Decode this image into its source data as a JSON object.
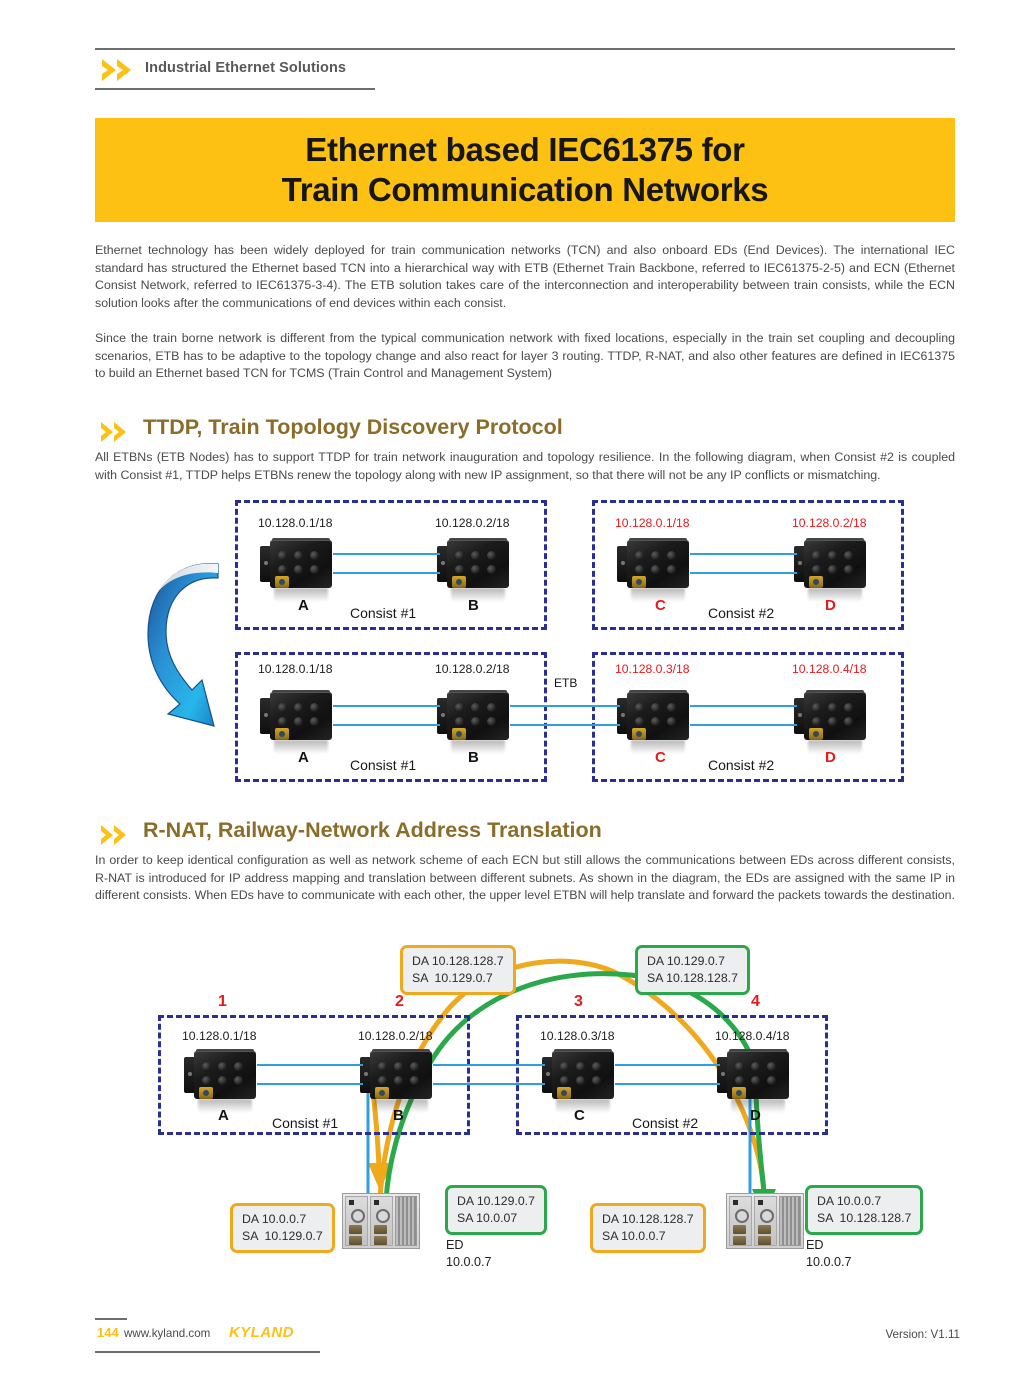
{
  "header": {
    "title": "Industrial Ethernet Solutions",
    "chevron_icon": "double-chevron-icon"
  },
  "banner": {
    "line1": "Ethernet based IEC61375 for",
    "line2": "Train Communication Networks",
    "bg_color": "#fcc113"
  },
  "intro": {
    "paragraph1": "Ethernet technology has been widely deployed for train communication networks (TCN) and also onboard EDs (End Devices). The international IEC standard has structured the Ethernet based TCN into a hierarchical way with ETB (Ethernet Train Backbone, referred to IEC61375-2-5) and ECN (Ethernet Consist Network, referred to IEC61375-3-4). The ETB solution takes care of the interconnection and interoperability between train consists, while the ECN solution looks after the communications of end devices within each consist.",
    "paragraph2": "Since the train borne network is different from the typical communication network with fixed locations, especially in the train set coupling and decoupling scenarios, ETB has to be adaptive to the topology change and also react for layer 3 routing. TTDP, R-NAT, and also other features are defined in IEC61375 to build an Ethernet based TCN for TCMS (Train Control and Management System)"
  },
  "section_ttdp": {
    "heading": "TTDP, Train Topology Discovery Protocol",
    "body": "All ETBNs (ETB Nodes) has to support TTDP for train network inauguration and topology resilience. In the following diagram, when Consist #2 is coupled with Consist #1, TTDP helps ETBNs renew the topology along with new IP assignment, so that there will not be any IP conflicts or mismatching."
  },
  "ttdp_diagram": {
    "arrow_icon": "curved-down-arrow-icon",
    "etb_label": "ETB",
    "row_before": {
      "consist1": {
        "name": "Consist #1",
        "devices": [
          {
            "letter": "A",
            "ip": "10.128.0.1/18",
            "ip_color": "#1c1c1c",
            "letter_color": "#141414"
          },
          {
            "letter": "B",
            "ip": "10.128.0.2/18",
            "ip_color": "#1c1c1c",
            "letter_color": "#141414"
          }
        ]
      },
      "consist2": {
        "name": "Consist #2",
        "devices": [
          {
            "letter": "C",
            "ip": "10.128.0.1/18",
            "ip_color": "#e8191b",
            "letter_color": "#e8191b"
          },
          {
            "letter": "D",
            "ip": "10.128.0.2/18",
            "ip_color": "#e8191b",
            "letter_color": "#e8191b"
          }
        ]
      }
    },
    "row_after": {
      "consist1": {
        "name": "Consist #1",
        "devices": [
          {
            "letter": "A",
            "ip": "10.128.0.1/18",
            "ip_color": "#1c1c1c",
            "letter_color": "#141414"
          },
          {
            "letter": "B",
            "ip": "10.128.0.2/18",
            "ip_color": "#1c1c1c",
            "letter_color": "#141414"
          }
        ]
      },
      "consist2": {
        "name": "Consist #2",
        "devices": [
          {
            "letter": "C",
            "ip": "10.128.0.3/18",
            "ip_color": "#e8191b",
            "letter_color": "#e8191b"
          },
          {
            "letter": "D",
            "ip": "10.128.0.4/18",
            "ip_color": "#e8191b",
            "letter_color": "#e8191b"
          }
        ]
      }
    }
  },
  "section_rnat": {
    "heading": "R-NAT, Railway-Network Address Translation",
    "body": "In order to keep identical configuration as well as network scheme of each ECN but still allows the communications between EDs across different consists, R-NAT is introduced for IP address mapping and translation between different subnets. As shown in the diagram, the EDs are assigned with the same IP in different consists. When EDs have to communicate with each other, the upper level ETBN will help translate and forward the packets towards the destination."
  },
  "rnat_diagram": {
    "numbers": [
      "1",
      "2",
      "3",
      "4"
    ],
    "consist1": {
      "name": "Consist #1",
      "devices": [
        {
          "letter": "A",
          "ip": "10.128.0.1/18"
        },
        {
          "letter": "B",
          "ip": "10.128.0.2/18"
        }
      ]
    },
    "consist2": {
      "name": "Consist #2",
      "devices": [
        {
          "letter": "C",
          "ip": "10.128.0.3/18"
        },
        {
          "letter": "D",
          "ip": "10.128.0.4/18"
        }
      ]
    },
    "callouts": {
      "top_left": {
        "da": "DA 10.128.128.7",
        "sa": "SA  10.129.0.7",
        "border_color": "#f0a81d"
      },
      "top_right": {
        "da": "DA 10.129.0.7",
        "sa": "SA 10.128.128.7",
        "border_color": "#2aa84a"
      },
      "bottom_left_orange": {
        "da": "DA 10.0.0.7",
        "sa": "SA  10.129.0.7",
        "border_color": "#f0a81d"
      },
      "bottom_left_green": {
        "da": "DA 10.129.0.7",
        "sa": "SA 10.0.07",
        "border_color": "#2aa84a"
      },
      "bottom_right_orange": {
        "da": "DA 10.128.128.7",
        "sa": "SA 10.0.0.7",
        "border_color": "#f0a81d"
      },
      "bottom_right_green": {
        "da": "DA 10.0.0.7",
        "sa": "SA  10.128.128.7",
        "border_color": "#2aa84a"
      }
    },
    "ed_left": {
      "label": "ED",
      "ip": "10.0.0.7"
    },
    "ed_right": {
      "label": "ED",
      "ip": "10.0.0.7"
    }
  },
  "footer": {
    "page_number": "144",
    "url": "www.kyland.com",
    "brand": "KYLAND",
    "version": "Version: V1.11"
  }
}
